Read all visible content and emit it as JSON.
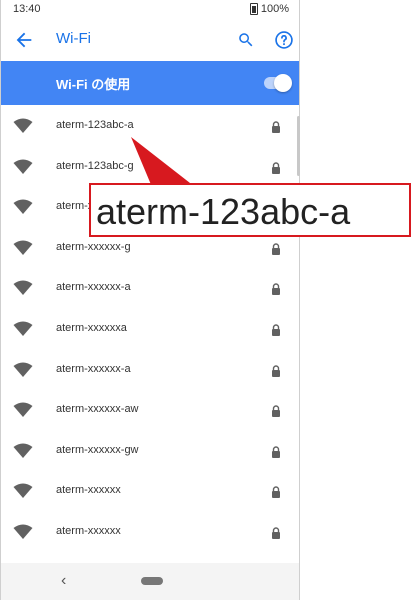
{
  "status_bar": {
    "time": "13:40",
    "battery": "100%"
  },
  "app_bar": {
    "title": "Wi-Fi",
    "back_icon": "arrow-back-icon",
    "search_icon": "search-icon",
    "help_icon": "help-icon"
  },
  "wifi_toggle": {
    "label": "Wi-Fi の使用",
    "enabled": true,
    "accent": "#4285f4"
  },
  "networks": [
    {
      "ssid": "aterm-123abc-a",
      "secured": true
    },
    {
      "ssid": "aterm-123abc-g",
      "secured": true
    },
    {
      "ssid": "aterm-xxxxxx-g",
      "secured": true
    },
    {
      "ssid": "aterm-xxxxxx-g",
      "secured": true
    },
    {
      "ssid": "aterm-xxxxxx-a",
      "secured": true
    },
    {
      "ssid": "aterm-xxxxxxa",
      "secured": true
    },
    {
      "ssid": "aterm-xxxxxx-a",
      "secured": true
    },
    {
      "ssid": "aterm-xxxxxx-aw",
      "secured": true
    },
    {
      "ssid": "aterm-xxxxxx-gw",
      "secured": true
    },
    {
      "ssid": "aterm-xxxxxx",
      "secured": true
    },
    {
      "ssid": "aterm-xxxxxx",
      "secured": true
    }
  ],
  "callout": {
    "text": "aterm-123abc-a",
    "border_color": "#d7191f"
  }
}
